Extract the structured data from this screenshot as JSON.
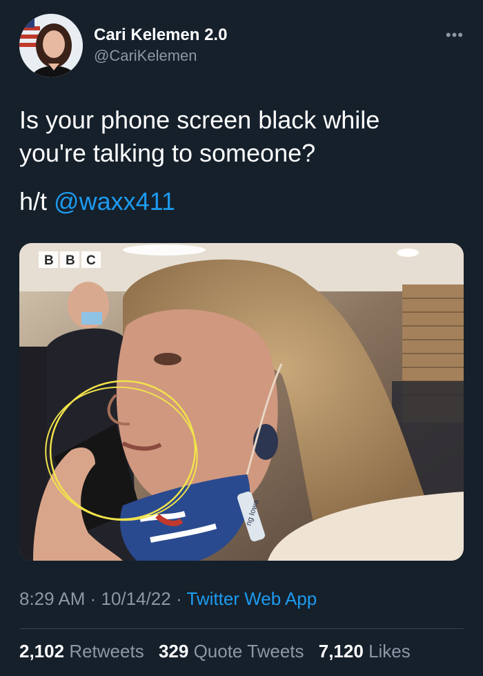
{
  "author": {
    "display_name": "Cari Kelemen 2.0",
    "handle": "@CariKelemen",
    "avatar_icon": "profile-photo"
  },
  "more_icon": "ellipsis-icon",
  "tweet": {
    "text": "Is your phone screen black while you're talking to someone?",
    "ht_prefix": "h/t ",
    "mention": "@waxx411"
  },
  "media": {
    "watermark_letters": [
      "B",
      "B",
      "C"
    ],
    "lanyard_text": "ng Iowa"
  },
  "meta": {
    "time": "8:29 AM",
    "sep1": " · ",
    "date": "10/14/22",
    "sep2": " · ",
    "app": "Twitter Web App"
  },
  "stats": {
    "retweets_count": "2,102",
    "retweets_label": "Retweets",
    "quotes_count": "329",
    "quotes_label": "Quote Tweets",
    "likes_count": "7,120",
    "likes_label": "Likes"
  },
  "colors": {
    "background": "#15202b",
    "link": "#1d9bf0",
    "secondary_text": "#8b98a5",
    "annotation_circle": "#f2e34b"
  }
}
